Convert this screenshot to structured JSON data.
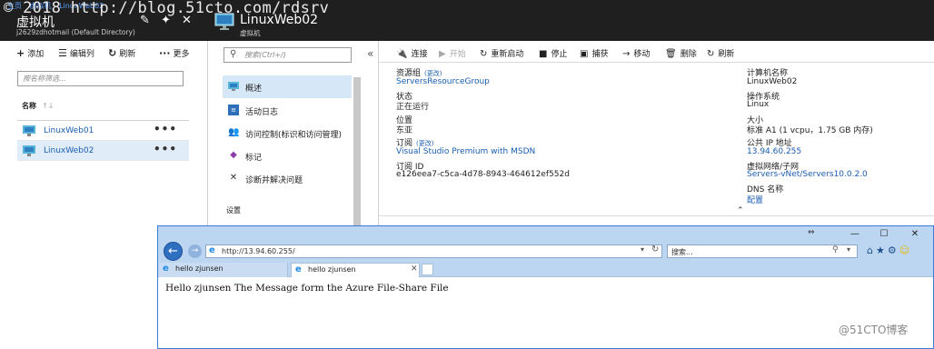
{
  "portal": {
    "breadcrumb": [
      "主页",
      "虚拟机",
      "LinuxWeb02"
    ],
    "watermark_text": "© 2018 http://blog.51cto.com/rdsrv",
    "blade1": {
      "title": "虚拟机",
      "subtitle": "j2629zdhotmail (Default Directory)",
      "controls": [
        "«",
        "✕"
      ],
      "toolbar": {
        "add": "添加",
        "edit_columns": "编辑列",
        "refresh": "刷新",
        "more": "更多"
      },
      "filter_placeholder": "按名称筛选...",
      "column_name": "名称",
      "sort_glyph": "↑↓",
      "vms": [
        {
          "name": "LinuxWeb01",
          "selected": false
        },
        {
          "name": "LinuxWeb02",
          "selected": true
        }
      ],
      "row_more": "•••"
    },
    "blade2": {
      "title": "LinuxWeb02",
      "subtitle": "虚拟机",
      "search_placeholder": "搜索(Ctrl+/)",
      "collapse_glyph": "«",
      "menu": [
        {
          "label": "概述",
          "icon": "vm-overview-icon",
          "selected": true
        },
        {
          "label": "活动日志",
          "icon": "activity-log-icon",
          "selected": false
        },
        {
          "label": "访问控制(标识和访问管理)",
          "icon": "iam-icon",
          "selected": false
        },
        {
          "label": "标记",
          "icon": "tag-icon",
          "selected": false
        },
        {
          "label": "诊断并解决问题",
          "icon": "wrench-icon",
          "selected": false
        }
      ],
      "section_settings": "设置"
    },
    "commands": [
      {
        "label": "连接",
        "icon": "connect-icon",
        "enabled": true
      },
      {
        "label": "开始",
        "icon": "play-icon",
        "enabled": false
      },
      {
        "label": "重新启动",
        "icon": "restart-icon",
        "enabled": true
      },
      {
        "label": "停止",
        "icon": "stop-icon",
        "enabled": true
      },
      {
        "label": "捕获",
        "icon": "capture-icon",
        "enabled": true
      },
      {
        "label": "移动",
        "icon": "move-icon",
        "enabled": true
      },
      {
        "label": "删除",
        "icon": "delete-icon",
        "enabled": true
      },
      {
        "label": "刷新",
        "icon": "refresh-icon",
        "enabled": true
      }
    ],
    "essentials": {
      "change_label": "(更改)",
      "resource_group_label": "资源组",
      "resource_group_value": "ServersResourceGroup",
      "status_label": "状态",
      "status_value": "正在运行",
      "location_label": "位置",
      "location_value": "东亚",
      "subscription_label": "订阅",
      "subscription_value": "Visual Studio Premium with MSDN",
      "subscription_id_label": "订阅 ID",
      "subscription_id_value": "e126eea7-c5ca-4d78-8943-464612ef552d",
      "computer_name_label": "计算机名称",
      "computer_name_value": "LinuxWeb02",
      "os_label": "操作系统",
      "os_value": "Linux",
      "size_label": "大小",
      "size_value": "标准 A1 (1 vcpu，1.75 GB 内存)",
      "public_ip_label": "公共 IP 地址",
      "public_ip_value": "13.94.60.255",
      "vnet_label": "虚拟网络/子网",
      "vnet_value": "Servers-vNet/Servers10.0.2.0",
      "dns_label": "DNS 名称",
      "dns_value": "配置",
      "collapse_glyph": "⌃"
    }
  },
  "ie": {
    "url": "http://13.94.60.255/",
    "search_placeholder": "搜索...",
    "resize_glyph": "⇔",
    "window_buttons": [
      "—",
      "☐",
      "✕"
    ],
    "tabs": [
      {
        "title": "hello zjunsen",
        "active": false
      },
      {
        "title": "hello zjunsen",
        "active": true
      }
    ],
    "tab_close": "✕",
    "page_text": "Hello zjunsen The Message form the Azure File-Share File"
  },
  "source_watermark": "@51CTO博客",
  "colors": {
    "portal_header": "#1f1f1f",
    "link_blue": "#1a5eb0",
    "selection": "#d6e8f7",
    "ie_chrome": "#bcd5f0"
  }
}
